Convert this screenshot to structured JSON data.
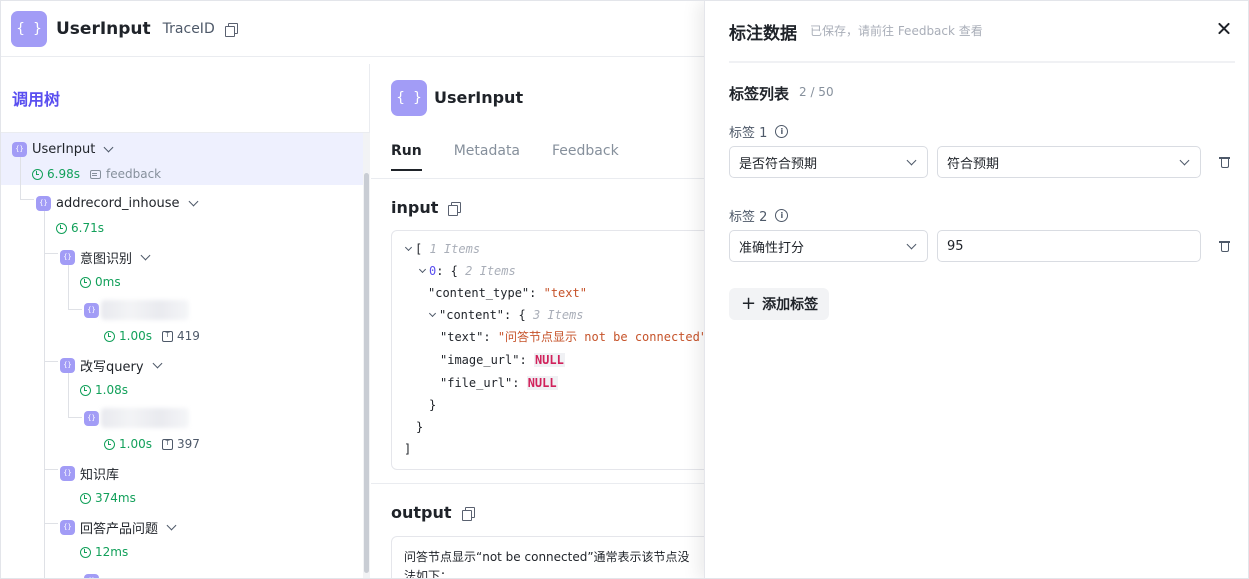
{
  "header": {
    "icon_glyph": "{ }",
    "title": "UserInput",
    "trace_label": "TraceID"
  },
  "tree": {
    "title": "调用树",
    "nodes": [
      {
        "name": "UserInput",
        "duration": "6.98s",
        "feedback": "feedback"
      },
      {
        "name": "addrecord_inhouse",
        "duration": "6.71s"
      },
      {
        "name": "意图识别",
        "duration": "0ms",
        "child_duration": "1.00s",
        "child_tokens": "419"
      },
      {
        "name": "改写query",
        "duration": "1.08s",
        "child_duration": "1.00s",
        "child_tokens": "397"
      },
      {
        "name": "知识库",
        "duration": "374ms"
      },
      {
        "name": "回答产品问题",
        "duration": "12ms"
      }
    ]
  },
  "detail": {
    "title": "UserInput",
    "tabs": [
      "Run",
      "Metadata",
      "Feedback"
    ],
    "input_title": "input",
    "output_title": "output",
    "json": {
      "root_bracket": "[",
      "root_count": "1 Items",
      "item_index": "0",
      "item_count": "2 Items",
      "k_content_type": "\"content_type\"",
      "v_content_type": "\"text\"",
      "k_content": "\"content\"",
      "content_count": "3 Items",
      "k_text": "\"text\"",
      "v_text": "\"问答节点显示 not be connected\"",
      "k_image_url": "\"image_url\"",
      "v_image_url": "NULL",
      "k_file_url": "\"file_url\"",
      "v_file_url": "NULL",
      "close_brace": "}",
      "close_bracket": "]"
    },
    "output_line1": "问答节点显示“not be connected”通常表示该节点没",
    "output_line2": "法如下："
  },
  "drawer": {
    "title": "标注数据",
    "subtitle": "已保存，请前往 Feedback 查看",
    "list_title": "标签列表",
    "list_count": "2 / 50",
    "tags": [
      {
        "label": "标签 1",
        "key": "是否符合预期",
        "value": "符合预期"
      },
      {
        "label": "标签 2",
        "key": "准确性打分",
        "value": "95"
      }
    ],
    "add_label": "添加标签"
  },
  "colors": {
    "accent": "#5a4ff0",
    "icon_bg": "#a29cf6",
    "duration": "#12a05a",
    "json_string": "#c6532a",
    "json_null": "#d1225b"
  }
}
